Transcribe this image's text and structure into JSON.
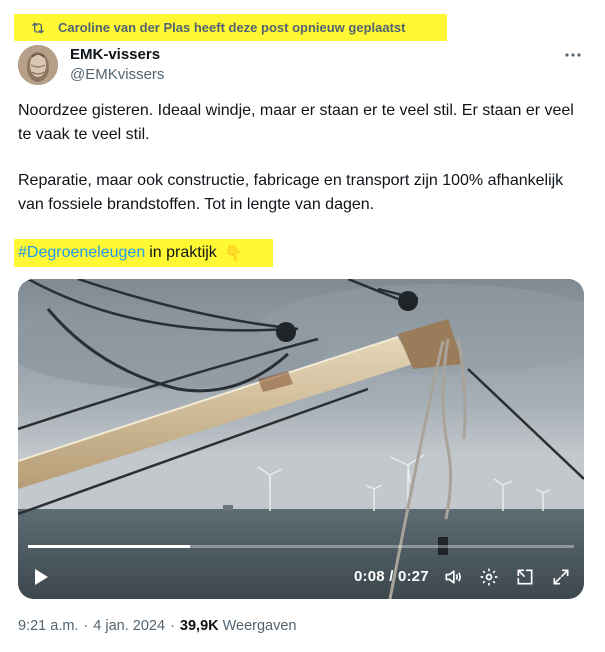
{
  "retweet": {
    "icon": "retweet-icon",
    "text": "Caroline van der Plas heeft deze post opnieuw geplaatst",
    "highlight_color": "#fff833"
  },
  "author": {
    "display_name": "EMK-vissers",
    "handle": "@EMKvissers",
    "avatar_icon": "avatar-image"
  },
  "menu": {
    "icon": "more-icon"
  },
  "tweet": {
    "paragraph_1": "Noordzee gisteren. Ideaal windje, maar er staan er te veel stil. Er staan er veel te vaak te veel stil.",
    "paragraph_2": "Reparatie, maar ook constructie, fabricage en transport zijn 100% afhankelijk van fossiele brandstoffen. Tot in lengte van dagen.",
    "hashtag": "#Degroeneleugen",
    "hashtag_rest": "in praktijk",
    "emoji": "👇",
    "link_color": "#1d9bf0"
  },
  "video": {
    "current_time": "0:08",
    "separator": " / ",
    "duration": "0:27",
    "progress_fraction": 0.296,
    "controls": [
      "play-icon",
      "volume-icon",
      "settings-icon",
      "popout-icon",
      "fullscreen-icon"
    ]
  },
  "meta": {
    "time": "9:21 a.m.",
    "dot": "·",
    "date": "4 jan. 2024",
    "views_count": "39,9K",
    "views_label": "Weergaven"
  }
}
